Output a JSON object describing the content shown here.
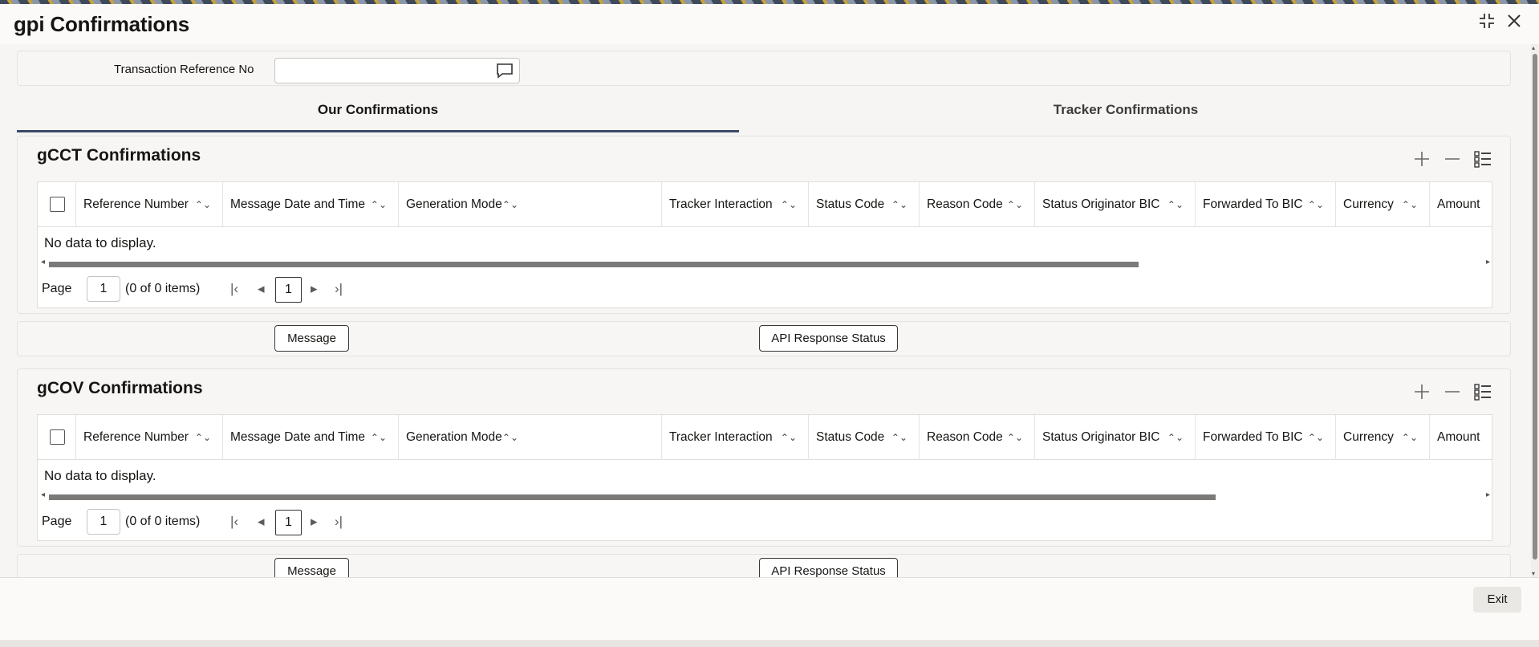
{
  "window": {
    "title": "gpi Confirmations",
    "restore_icon": "shrink-icon",
    "close_icon": "close-icon",
    "close_glyph": "✕",
    "restore_glyph": "⤡"
  },
  "header": {
    "txn_ref_label": "Transaction Reference No",
    "txn_ref_value": "",
    "lookup_icon": "speech-bubble-icon"
  },
  "tabs": [
    {
      "label": "Our Confirmations",
      "active": true
    },
    {
      "label": "Tracker Confirmations",
      "active": false
    }
  ],
  "columns": [
    "Reference Number",
    "Message Date and Time",
    "Generation Mode",
    "Tracker Interaction",
    "Status Code",
    "Reason Code",
    "Status Originator BIC",
    "Forwarded To BIC",
    "Currency",
    "Amount"
  ],
  "sections": [
    {
      "title": "gCCT Confirmations",
      "no_data": "No data to display.",
      "page_label": "Page",
      "page_value": "1",
      "items_text": "(0 of 0 items)",
      "current_page": "1",
      "buttons": {
        "message": "Message",
        "api": "API Response Status"
      }
    },
    {
      "title": "gCOV Confirmations",
      "no_data": "No data to display.",
      "page_label": "Page",
      "page_value": "1",
      "items_text": "(0 of 0 items)",
      "current_page": "1",
      "buttons": {
        "message": "Message",
        "api": "API Response Status"
      }
    }
  ],
  "footer": {
    "exit_label": "Exit"
  },
  "colors": {
    "tab_underline": "#3a4a6a",
    "scroll_thumb": "#7b7a78"
  }
}
